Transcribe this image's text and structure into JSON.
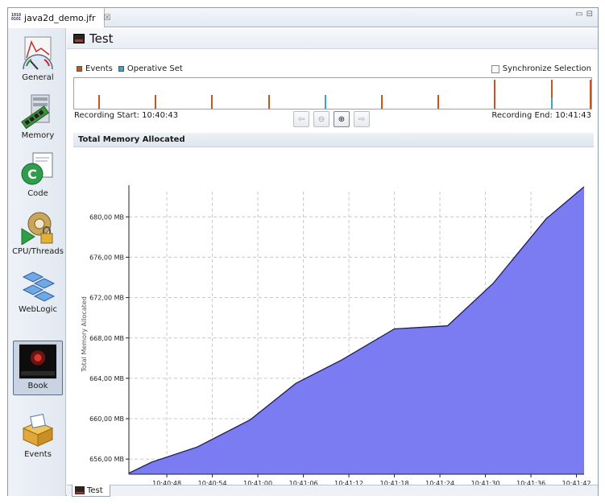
{
  "editor_tab": {
    "label": "java2d_demo.jfr",
    "icon": "binary-file-icon",
    "close_glyph": "☒"
  },
  "window_controls": {
    "minimize": "▭",
    "maximize": "⊟"
  },
  "sidebar": {
    "items": [
      {
        "label": "General",
        "icon": "gauge-chart-icon",
        "active": false
      },
      {
        "label": "Memory",
        "icon": "memory-module-icon",
        "active": false
      },
      {
        "label": "Code",
        "icon": "code-class-icon",
        "active": false
      },
      {
        "label": "CPU/Threads",
        "icon": "cpu-gear-lock-icon",
        "active": false
      },
      {
        "label": "WebLogic",
        "icon": "weblogic-cubes-icon",
        "active": false
      },
      {
        "label": "Book",
        "icon": "book-cover-icon",
        "active": true
      },
      {
        "label": "Events",
        "icon": "events-box-icon",
        "active": false
      }
    ]
  },
  "page": {
    "title": "Test"
  },
  "legend": {
    "events_label": "Events",
    "operative_label": "Operative Set",
    "events_color": "#c8541f",
    "operative_color": "#3aa7c9"
  },
  "sync_label": "Synchronize Selection",
  "recording": {
    "start_label": "Recording Start: 10:40:43",
    "end_label": "Recording End: 10:41:43"
  },
  "zoom_buttons": [
    {
      "name": "back",
      "glyph": "⇦",
      "enabled": false
    },
    {
      "name": "zoom-out",
      "glyph": "⊖",
      "enabled": false
    },
    {
      "name": "zoom-in",
      "glyph": "⊕",
      "enabled": true
    },
    {
      "name": "forward",
      "glyph": "⇨",
      "enabled": false
    }
  ],
  "section": {
    "title": "Total Memory Allocated"
  },
  "bottom_tab": {
    "label": "Test"
  },
  "timeline_events": [
    {
      "t": 0.046,
      "h": 0.45,
      "type": "event"
    },
    {
      "t": 0.156,
      "h": 0.45,
      "type": "event"
    },
    {
      "t": 0.265,
      "h": 0.45,
      "type": "event"
    },
    {
      "t": 0.375,
      "h": 0.45,
      "type": "event"
    },
    {
      "t": 0.484,
      "h": 0.45,
      "type": "operative"
    },
    {
      "t": 0.594,
      "h": 0.45,
      "type": "event"
    },
    {
      "t": 0.703,
      "h": 0.45,
      "type": "event"
    },
    {
      "t": 0.812,
      "h": 0.95,
      "type": "event"
    },
    {
      "t": 0.922,
      "h": 0.95,
      "type": "event"
    },
    {
      "t": 0.922,
      "h": 0.35,
      "type": "operative"
    },
    {
      "t": 0.998,
      "h": 0.95,
      "type": "event"
    }
  ],
  "chart_data": {
    "type": "area",
    "ylabel": "Total Memory Allocated",
    "xlabel": "",
    "fill_color": "#7b7bf2",
    "line_color": "#1e1e55",
    "ylim": [
      654.5,
      682.5
    ],
    "yticks": [
      656,
      660,
      664,
      668,
      672,
      676,
      680
    ],
    "ytick_labels": [
      "656,00 MB",
      "660,00 MB",
      "664,00 MB",
      "668,00 MB",
      "672,00 MB",
      "676,00 MB",
      "680,00 MB"
    ],
    "xlim_seconds": [
      0,
      60
    ],
    "xticks_seconds": [
      5,
      11,
      17,
      23,
      29,
      35,
      41,
      47,
      53,
      59
    ],
    "xtick_labels": [
      "10:40:48",
      "10:40:54",
      "10:41:00",
      "10:41:06",
      "10:41:12",
      "10:41:18",
      "10:41:24",
      "10:41:30",
      "10:41:36",
      "10:41:42"
    ],
    "x_seconds": [
      0,
      3,
      9,
      16,
      22,
      28,
      35,
      42,
      48,
      55,
      60
    ],
    "y_mb": [
      654.6,
      655.7,
      657.2,
      659.9,
      663.5,
      665.8,
      668.9,
      669.2,
      673.4,
      679.8,
      683.8
    ]
  }
}
